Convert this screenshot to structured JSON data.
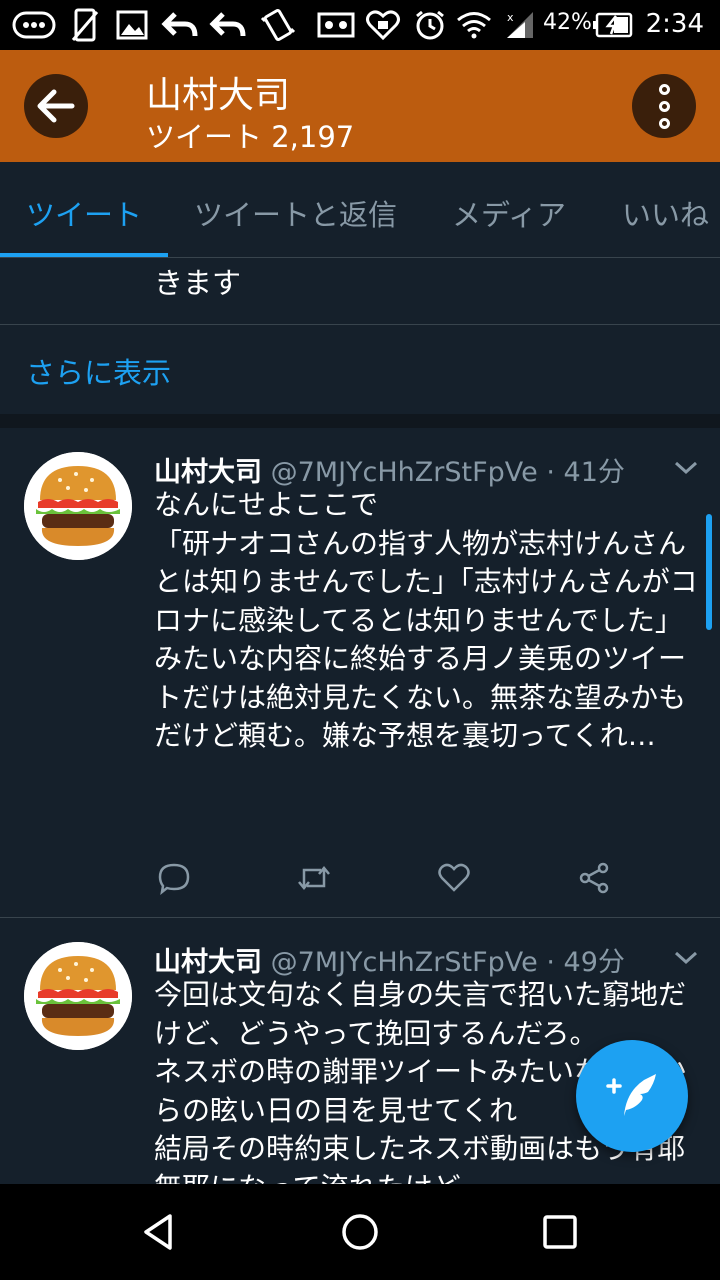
{
  "status_bar": {
    "battery_percent": "42%",
    "time": "2:34",
    "icons": [
      "more-icon",
      "phone-no-sim-icon",
      "image-icon",
      "back-arrow-icon",
      "back-arrow-icon",
      "vibrate-icon",
      "app-icon",
      "cat-icon",
      "heart-lock-icon",
      "alarm-icon",
      "wifi-icon",
      "signal-icon",
      "battery-charging-icon"
    ]
  },
  "app_bar": {
    "title": "山村大司",
    "subtitle": "ツイート 2,197",
    "accent_color": "#bc5c0f"
  },
  "tabs": [
    {
      "label": "ツイート",
      "active": true
    },
    {
      "label": "ツイートと返信",
      "active": false
    },
    {
      "label": "メディア",
      "active": false
    },
    {
      "label": "いいね",
      "active": false
    }
  ],
  "previous_tweet": {
    "tail_text": "きます",
    "show_more": "さらに表示"
  },
  "tweets": [
    {
      "name": "山村大司",
      "handle": "@7MJYcHhZrStFpVe",
      "sep": "·",
      "time": "41分",
      "body": "なんにせよここで\n「研ナオコさんの指す人物が志村けんさんとは知りませんでした」「志村けんさんがコロナに感染してるとは知りませんでした」\nみたいな内容に終始する月ノ美兎のツイートだけは絶対見たくない。無茶な望みかもだけど頼む。嫌な予想を裏切ってくれ…"
    },
    {
      "name": "山村大司",
      "handle": "@7MJYcHhZrStFpVe",
      "sep": "·",
      "time": "49分",
      "body": "今回は文句なく自身の失言で招いた窮地だけど、どうやって挽回するんだろ。\nネスボの時の謝罪ツイートみたいな状況からの眩い日の目を見せてくれ\n結局その時約束したネスボ動画はもう有耶無耶になって流れたけど"
    }
  ],
  "colors": {
    "background": "#15202b",
    "link": "#1da1f2",
    "secondary_text": "#8899a6",
    "divider": "#38444d"
  }
}
